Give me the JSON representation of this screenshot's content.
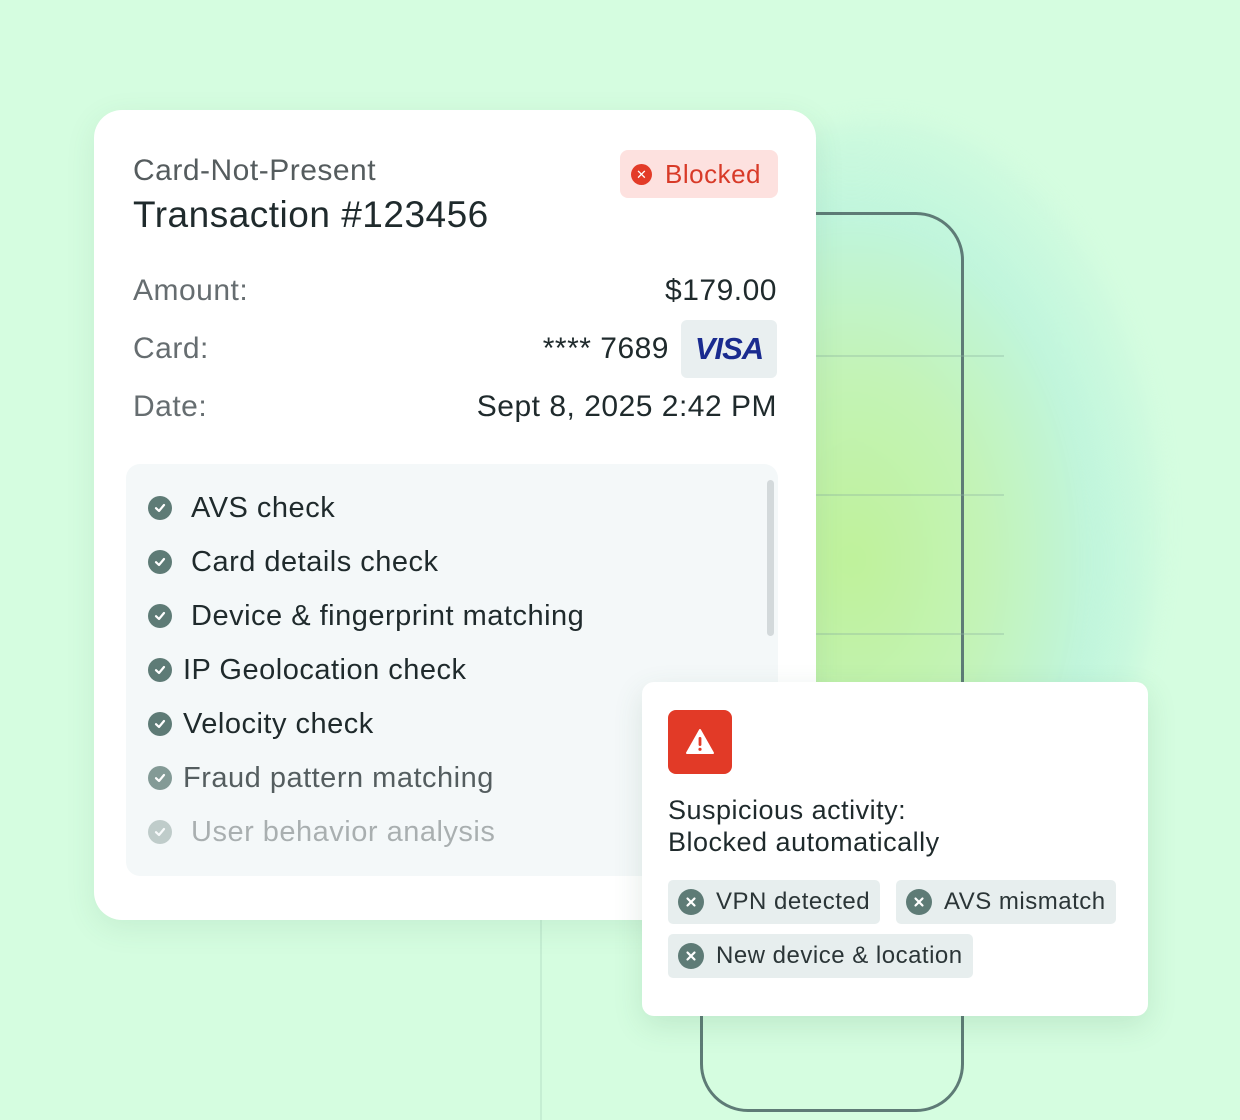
{
  "transaction": {
    "type_label": "Card-Not-Present",
    "title": "Transaction #123456",
    "status": "Blocked",
    "amount_label": "Amount:",
    "amount_value": "$179.00",
    "card_label": "Card:",
    "card_value": "**** 7689",
    "card_brand": "VISA",
    "date_label": "Date:",
    "date_value": "Sept 8, 2025 2:42 PM"
  },
  "checks": [
    {
      "label": "AVS check",
      "icon": "check-circle-icon"
    },
    {
      "label": "Card details check",
      "icon": "check-circle-icon"
    },
    {
      "label": "Device & fingerprint matching",
      "icon": "check-circle-icon"
    },
    {
      "label": "IP Geolocation check",
      "icon": "check-circle-icon"
    },
    {
      "label": "Velocity check",
      "icon": "check-circle-icon"
    },
    {
      "label": "Fraud pattern matching",
      "icon": "check-circle-icon"
    },
    {
      "label": "User behavior analysis",
      "icon": "check-circle-icon"
    }
  ],
  "alert": {
    "icon": "warning-icon",
    "line1": "Suspicious activity:",
    "line2": "Blocked automatically",
    "reasons": [
      {
        "label": "VPN detected",
        "icon": "x-circle-icon"
      },
      {
        "label": "AVS mismatch",
        "icon": "x-circle-icon"
      },
      {
        "label": "New device & location",
        "icon": "x-circle-icon"
      }
    ]
  },
  "colors": {
    "background": "#d5fde0",
    "blocked_red": "#e23a27",
    "check_green": "#5e7b76",
    "text_dark": "#1f2a2c"
  }
}
